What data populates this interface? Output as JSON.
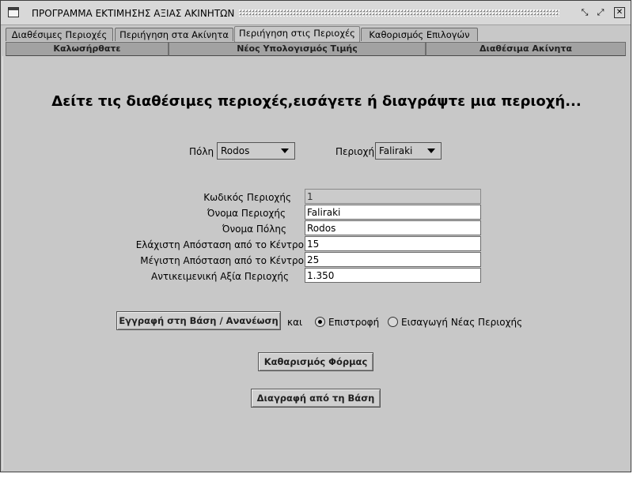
{
  "window": {
    "title": "ΠΡΟΓΡΑΜΜΑ ΕΚΤΙΜΗΣΗΣ ΑΞΙΑΣ ΑΚΙΝΗΤΩΝ",
    "controls": [
      "minimize-icon",
      "maximize-icon",
      "close-icon"
    ]
  },
  "tabs_row1": [
    {
      "label": "Διαθέσιμες Περιοχές",
      "selected": false
    },
    {
      "label": "Περιήγηση στα Ακίνητα",
      "selected": false
    },
    {
      "label": "Περιήγηση στις Περιοχές",
      "selected": true
    },
    {
      "label": "Καθορισμός Επιλογών",
      "selected": false
    }
  ],
  "tabs_row2": [
    {
      "label": "Καλωσήρθατε"
    },
    {
      "label": "Νέος Υπολογισμός Τιμής"
    },
    {
      "label": "Διαθέσιμα Ακίνητα"
    }
  ],
  "heading": "Δείτε τις διαθέσιμες περιοχές,εισάγετε ή διαγράψτε μια περιοχή...",
  "selectors": {
    "city": {
      "label": "Πόλη",
      "value": "Rodos"
    },
    "area": {
      "label": "Περιοχή",
      "value": "Faliraki"
    }
  },
  "form": {
    "area_code": {
      "label": "Κωδικός Περιοχής",
      "value": "1"
    },
    "area_name": {
      "label": "Όνομα Περιοχής",
      "value": "Faliraki"
    },
    "city_name": {
      "label": "Όνομα Πόλης",
      "value": "Rodos"
    },
    "min_distance": {
      "label": "Ελάχιστη Απόσταση από το Κέντρο",
      "value": "15"
    },
    "max_distance": {
      "label": "Μέγιστη Απόσταση από το Κέντρο",
      "value": "25"
    },
    "objective_value": {
      "label": "Αντικειμενική Αξία Περιοχής",
      "value": "1.350"
    }
  },
  "actions": {
    "save_label": "Εγγραφή στη Βάση / Ανανέωση",
    "and_label": "και",
    "radio_return": {
      "label": "Επιστροφή",
      "checked": true
    },
    "radio_new": {
      "label": "Εισαγωγή Νέας Περιοχής",
      "checked": false
    },
    "clear_label": "Καθαρισμός Φόρμας",
    "delete_label": "Διαγραφή από τη Βάση"
  }
}
